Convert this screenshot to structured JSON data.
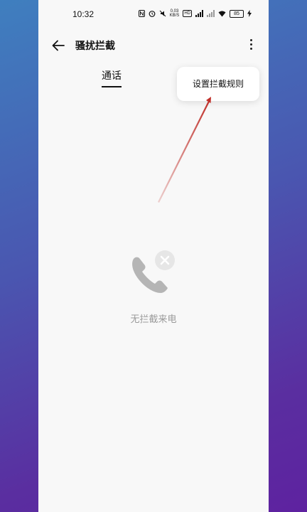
{
  "status_bar": {
    "time": "10:32",
    "net_speed_value": "0.03",
    "net_speed_unit": "KB/S",
    "hd_label": "HD",
    "battery_level": "85"
  },
  "header": {
    "title": "骚扰拦截"
  },
  "tabs": [
    {
      "label": "通话",
      "selected": true
    }
  ],
  "menu": {
    "items": [
      {
        "label": "设置拦截规则"
      }
    ]
  },
  "empty_state": {
    "text": "无拦截来电"
  },
  "colors": {
    "annotation_arrow": "#c0302a",
    "empty_icon": "#b5b5b5"
  }
}
